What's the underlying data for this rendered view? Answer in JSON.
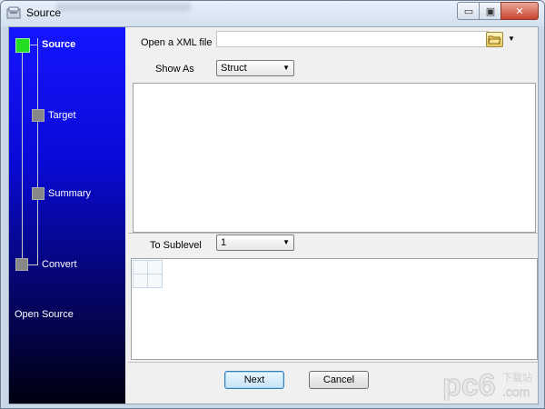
{
  "window": {
    "title": "Source"
  },
  "title_controls": {
    "minimize": "▭",
    "maximize": "▣",
    "close": "✕"
  },
  "sidebar": {
    "steps": [
      {
        "label": "Source",
        "active": true
      },
      {
        "label": "Target",
        "active": false
      },
      {
        "label": "Summary",
        "active": false
      },
      {
        "label": "Convert",
        "active": false
      }
    ],
    "footer_label": "Open Source",
    "colors": {
      "active_node": "#22dd22",
      "inactive_node": "#888888",
      "bg_top": "#1515ff",
      "bg_bottom": "#000010"
    }
  },
  "main": {
    "open_label": "Open a XML file",
    "file_value": "",
    "show_as_label": "Show As",
    "show_as_value": "Struct",
    "sublevel_label": "To Sublevel",
    "sublevel_value": "1"
  },
  "buttons": {
    "next": "Next",
    "cancel": "Cancel"
  },
  "watermark": {
    "text": "pc6",
    "sub": ".com",
    "cn": "下载站"
  }
}
